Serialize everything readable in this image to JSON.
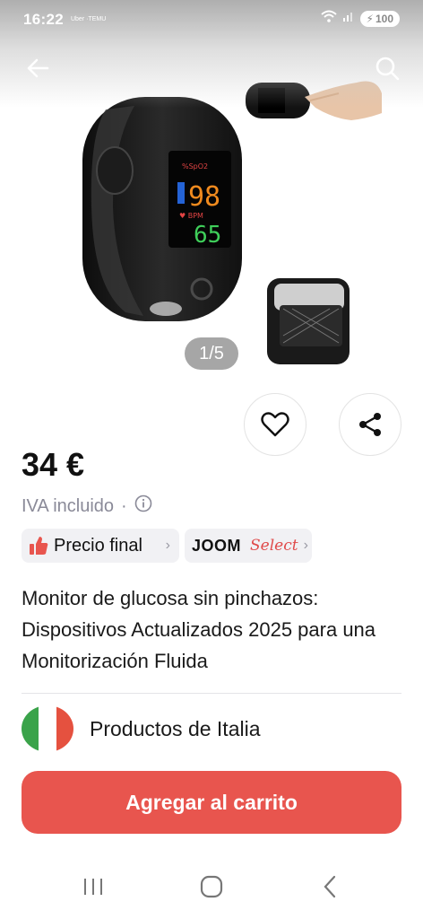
{
  "status_bar": {
    "time": "16:22",
    "app_icons": "Uber ·TEMU",
    "battery": "100"
  },
  "gallery": {
    "counter": "1/5",
    "device_display": {
      "spo2": "98",
      "pulse": "65"
    }
  },
  "product": {
    "price": "34 €",
    "vat_note": "IVA incluido",
    "vat_separator": "·",
    "title": "Monitor de glucosa sin pinchazos: Dispositivos Actualizados 2025 para una Monitorización Fluida"
  },
  "badges": {
    "final_price": "Precio final",
    "joom": "JOOM",
    "joom_select": "Select",
    "chevron": "›"
  },
  "origin": {
    "label": "Productos de Italia",
    "flag_colors": [
      "#3aa34a",
      "#ffffff",
      "#e5513f"
    ]
  },
  "cta": {
    "label": "Agregar al carrito"
  },
  "colors": {
    "accent": "#e8554e",
    "muted": "#8a8a98",
    "badge_bg": "#f1f1f4"
  },
  "icons": [
    "back-arrow-icon",
    "search-icon",
    "heart-icon",
    "share-icon",
    "info-icon",
    "thumbs-up-icon",
    "wifi-icon",
    "signal-icon"
  ]
}
